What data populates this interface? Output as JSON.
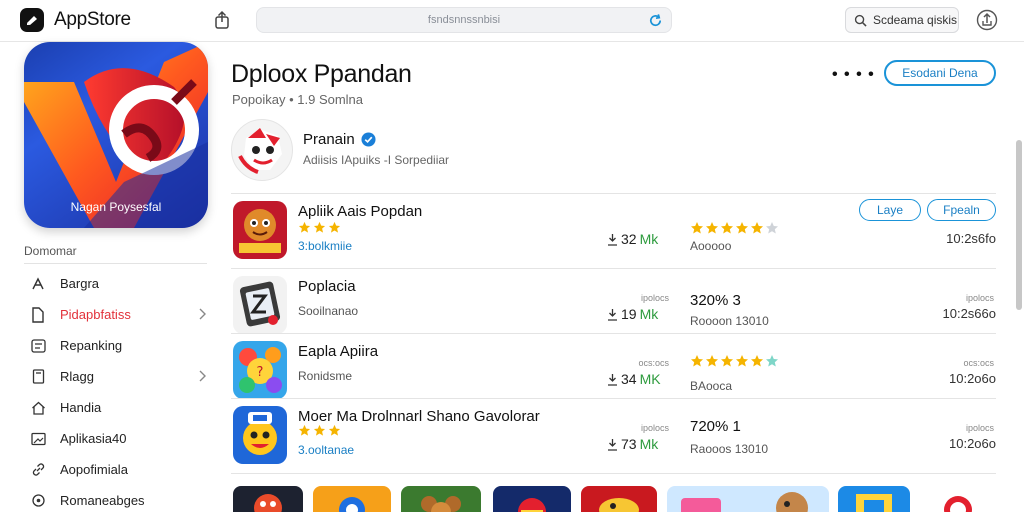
{
  "topbar": {
    "app_name": "AppStore",
    "url_text": "fsndsnnssnbisi",
    "search_label": "Scdeama qiskis"
  },
  "hero": {
    "caption": "Nagan Poysesfal"
  },
  "sidebar": {
    "heading": "Domomar",
    "items": [
      {
        "label": "Bargra",
        "icon": "arrow-icon"
      },
      {
        "label": "Pidapbfatiss",
        "icon": "document-icon",
        "active": true
      },
      {
        "label": "Repanking",
        "icon": "list-icon"
      },
      {
        "label": "Rlagg",
        "icon": "book-icon"
      },
      {
        "label": "Handia",
        "icon": "house-icon"
      },
      {
        "label": "Aplikasia40",
        "icon": "image-icon"
      },
      {
        "label": "Aopofimiala",
        "icon": "link-icon"
      },
      {
        "label": "Romaneabges",
        "icon": "circle-icon"
      }
    ]
  },
  "header": {
    "title": "Dploox Ppandan",
    "subtitle": "Popoikay • 1.9 Somlna",
    "more_label": "• • • •",
    "primary_button": "Esodani Dena"
  },
  "developer": {
    "name": "Pranain",
    "subtitle": "Adiisis IApuiks -I Sorpediiar"
  },
  "pills": {
    "left": "Laye",
    "right": "Fpealn"
  },
  "apps": [
    {
      "name": "Apliik Aais Popdan",
      "rating_count": "3:bolkmiie",
      "size_value": "32",
      "size_unit": "Mk",
      "stars": 4.5,
      "stat_sub": "Aooooo",
      "right_text": "10:2s6fo"
    },
    {
      "name": "Poplacia",
      "sub": "Sooilnanao",
      "size_small": "ipolocs",
      "size_value": "19",
      "size_unit": "Mk",
      "stat_main": "320% 3",
      "stat_sub": "Roooon 13010",
      "right_small": "ipolocs",
      "right_text": "10:2s66o"
    },
    {
      "name": "Eapla Apiira",
      "sub": "Ronidsme",
      "size_small": "ocs:ocs",
      "size_value": "34",
      "size_unit": "MK",
      "stars": 4.5,
      "stat_sub": "BAooca",
      "right_small": "ocs:ocs",
      "right_text": "10:2o6o"
    },
    {
      "name": "Moer Ma Drolnnarl Shano Gavolorar",
      "rating_count": "3.ooltanae",
      "size_small": "ipolocs",
      "size_value": "73",
      "size_unit": "Mk",
      "stat_main": "720% 1",
      "stat_sub": "Raooos 13010",
      "right_small": "ipolocs",
      "right_text": "10:2o6o"
    }
  ],
  "colors": {
    "accent": "#1a93d8",
    "active": "#e2313a",
    "star": "#f5b400",
    "unit": "#2e9b3e"
  }
}
